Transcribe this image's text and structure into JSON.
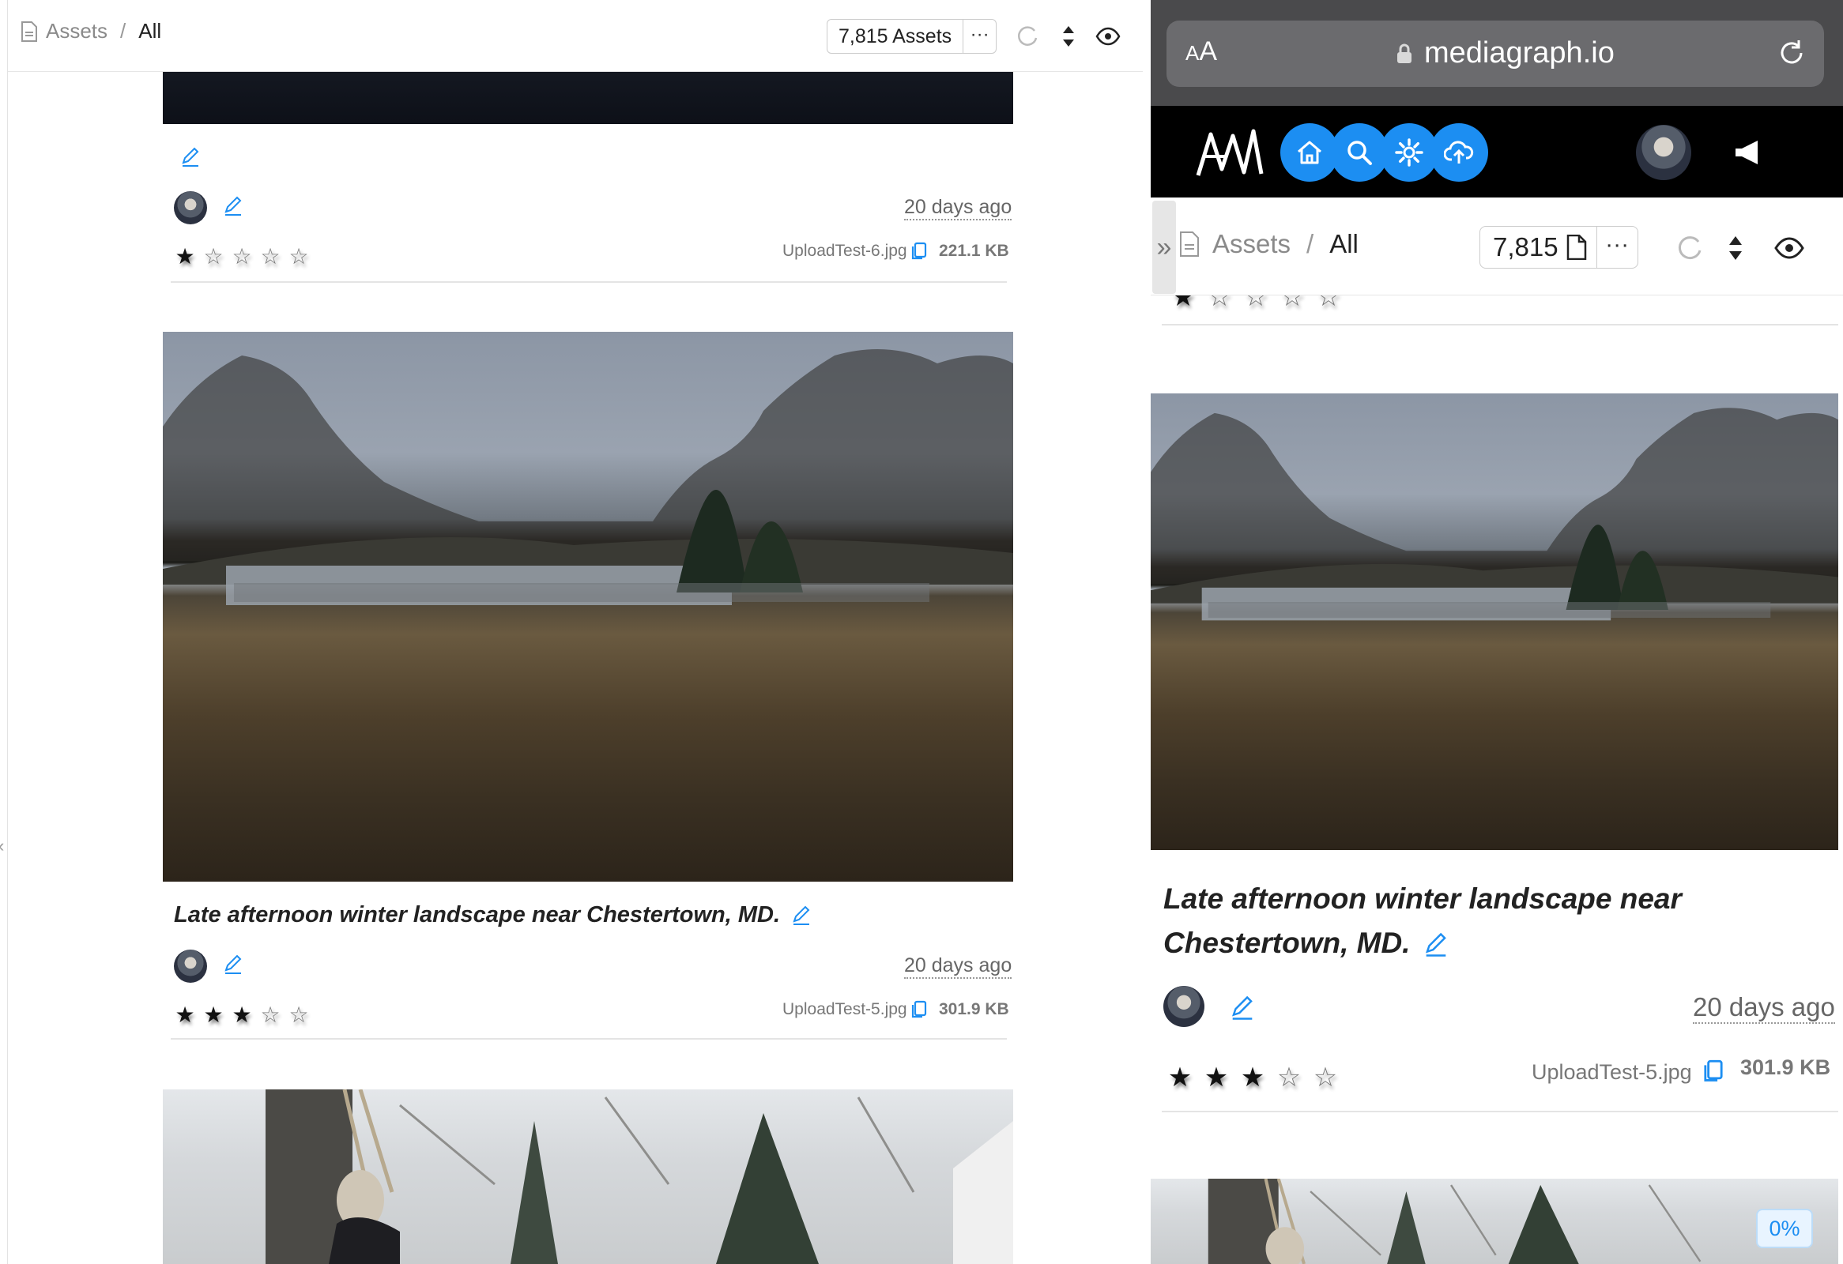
{
  "left": {
    "breadcrumb": {
      "root": "Assets",
      "separator": "/",
      "current": "All"
    },
    "asset_count_label": "7,815  Assets",
    "more_label": "···",
    "items": [
      {
        "time_ago": "20 days ago",
        "rating": 1,
        "filename": "UploadTest-6.jpg",
        "filesize": "221.1 KB"
      },
      {
        "title": "Late afternoon winter landscape near Chestertown, MD.",
        "time_ago": "20 days ago",
        "rating": 3,
        "filename": "UploadTest-5.jpg",
        "filesize": "301.9 KB"
      }
    ]
  },
  "right": {
    "browser": {
      "aa_small": "A",
      "aa_large": "A",
      "host": "mediagraph.io"
    },
    "nav": [
      "home-icon",
      "search-icon",
      "gear-icon",
      "upload-cloud-icon"
    ],
    "breadcrumb": {
      "expand": "»",
      "root": "Assets",
      "separator": "/",
      "current": "All"
    },
    "asset_count_label": "7,815",
    "more_label": "···",
    "item": {
      "title": "Late afternoon winter landscape near Chestertown, MD.",
      "time_ago": "20 days ago",
      "rating": 3,
      "filename": "UploadTest-5.jpg",
      "filesize": "301.9 KB"
    },
    "progress_label": "0%"
  },
  "colors": {
    "accent": "#1c8ef2",
    "app_bar": "#000000",
    "browser_chrome": "#4a4a4c"
  }
}
